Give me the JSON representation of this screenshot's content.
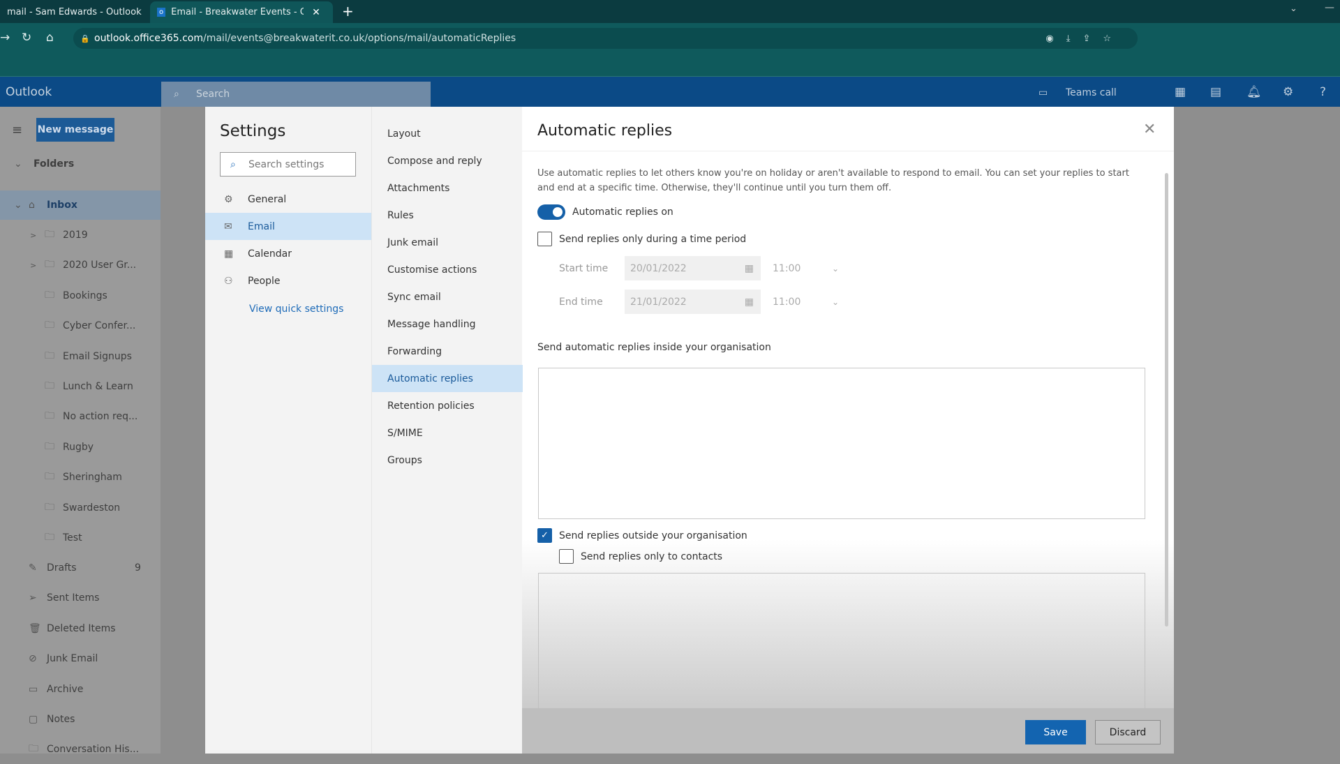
{
  "browser": {
    "tabs": [
      {
        "label": "mail - Sam Edwards - Outlook"
      },
      {
        "label": "Email - Breakwater Events - Outlo"
      }
    ],
    "url_domain": "outlook.office365.com",
    "url_path": "/mail/events@breakwaterit.co.uk/options/mail/automaticReplies"
  },
  "header": {
    "brand": "Outlook",
    "search_placeholder": "Search",
    "teams_call": "Teams call"
  },
  "sidebar": {
    "new_message": "New message",
    "folders": "Folders",
    "inbox": "Inbox",
    "subfolders": [
      "2019",
      "2020 User Gr...",
      "Bookings",
      "Cyber Confer...",
      "Email Signups",
      "Lunch & Learn",
      "No action req...",
      "Rugby",
      "Sheringham",
      "Swardeston",
      "Test"
    ],
    "items": [
      {
        "label": "Drafts",
        "count": "9",
        "icon": "pencil"
      },
      {
        "label": "Sent Items",
        "icon": "send"
      },
      {
        "label": "Deleted Items",
        "icon": "trash"
      },
      {
        "label": "Junk Email",
        "icon": "block"
      },
      {
        "label": "Archive",
        "icon": "archive"
      },
      {
        "label": "Notes",
        "icon": "note"
      },
      {
        "label": "Conversation His...",
        "icon": "folder"
      }
    ]
  },
  "settings": {
    "title": "Settings",
    "search_placeholder": "Search settings",
    "categories": [
      {
        "label": "General",
        "icon": "gear"
      },
      {
        "label": "Email",
        "icon": "mail"
      },
      {
        "label": "Calendar",
        "icon": "calendar"
      },
      {
        "label": "People",
        "icon": "people"
      }
    ],
    "selected_category": "Email",
    "view_quick": "View quick settings",
    "email_sections": [
      "Layout",
      "Compose and reply",
      "Attachments",
      "Rules",
      "Junk email",
      "Customise actions",
      "Sync email",
      "Message handling",
      "Forwarding",
      "Automatic replies",
      "Retention policies",
      "S/MIME",
      "Groups"
    ],
    "selected_section": "Automatic replies"
  },
  "auto": {
    "title": "Automatic replies",
    "description": "Use automatic replies to let others know you're on holiday or aren't available to respond to email. You can set your replies to start and end at a specific time. Otherwise, they'll continue until you turn them off.",
    "toggle_label": "Automatic replies on",
    "toggle_on": true,
    "time_period_label": "Send replies only during a time period",
    "time_period_checked": false,
    "start_label": "Start time",
    "start_date": "20/01/2022",
    "start_time": "11:00",
    "end_label": "End time",
    "end_date": "21/01/2022",
    "end_time": "11:00",
    "inside_label": "Send automatic replies inside your organisation",
    "inside_message": "",
    "outside_label": "Send replies outside your organisation",
    "outside_checked": true,
    "contacts_label": "Send replies only to contacts",
    "contacts_checked": false,
    "outside_message": "",
    "save": "Save",
    "discard": "Discard"
  },
  "colors": {
    "accent": "#1364b0",
    "browser": "#0f5a5c",
    "header": "#0b4a86"
  }
}
